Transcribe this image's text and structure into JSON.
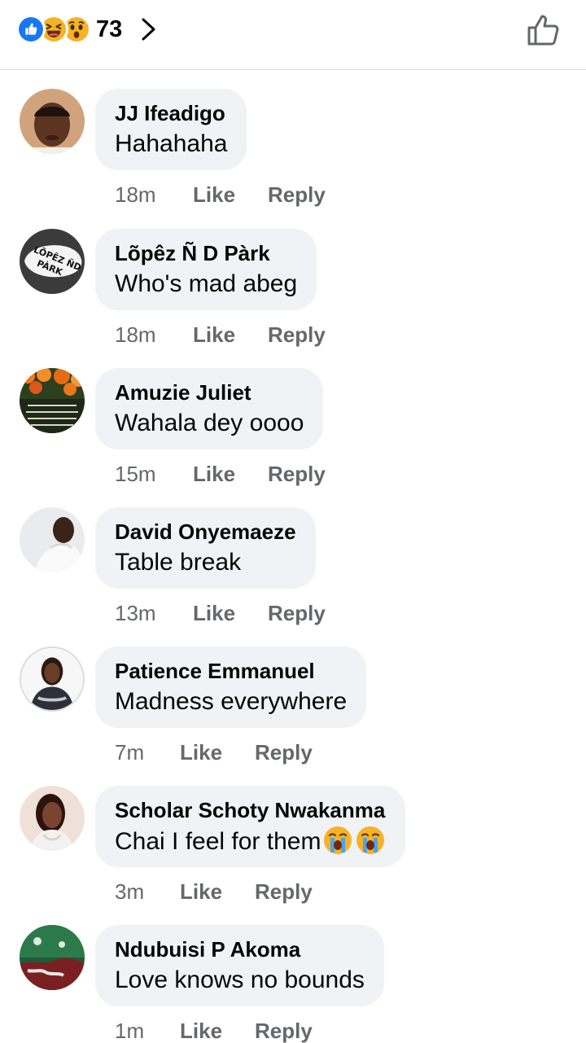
{
  "header": {
    "reaction_icons": [
      "like-icon",
      "haha-icon",
      "wow-icon"
    ],
    "reaction_count": "73",
    "chevron_icon": "chevron-right-icon",
    "like_button_icon": "thumbs-up-outline-icon"
  },
  "actions": {
    "like_label": "Like",
    "reply_label": "Reply"
  },
  "comments": [
    {
      "name": "JJ Ifeadigo",
      "text": "Hahahaha",
      "time": "18m"
    },
    {
      "name": "Lõpêz Ñ D Pàrk",
      "text": "Who's mad abeg",
      "time": "18m",
      "avatar_text": "LÕPÊZ ÑD PÀRK"
    },
    {
      "name": "Amuzie Juliet",
      "text": "Wahala dey oooo",
      "time": "15m"
    },
    {
      "name": "David Onyemaeze",
      "text": "Table break",
      "time": "13m"
    },
    {
      "name": "Patience Emmanuel",
      "text": "Madness everywhere",
      "time": "7m"
    },
    {
      "name": "Scholar Schoty Nwakanma",
      "text": "Chai I feel for them",
      "time": "3m",
      "emojis": [
        "loudly-crying-face",
        "loudly-crying-face"
      ]
    },
    {
      "name": "Ndubuisi P Akoma",
      "text": "Love knows no bounds",
      "time": "1m"
    }
  ],
  "colors": {
    "like_blue": "#1877f2",
    "reaction_yellow": "#f7b125",
    "bubble_bg": "#f0f2f5",
    "meta_gray": "#65676b"
  }
}
